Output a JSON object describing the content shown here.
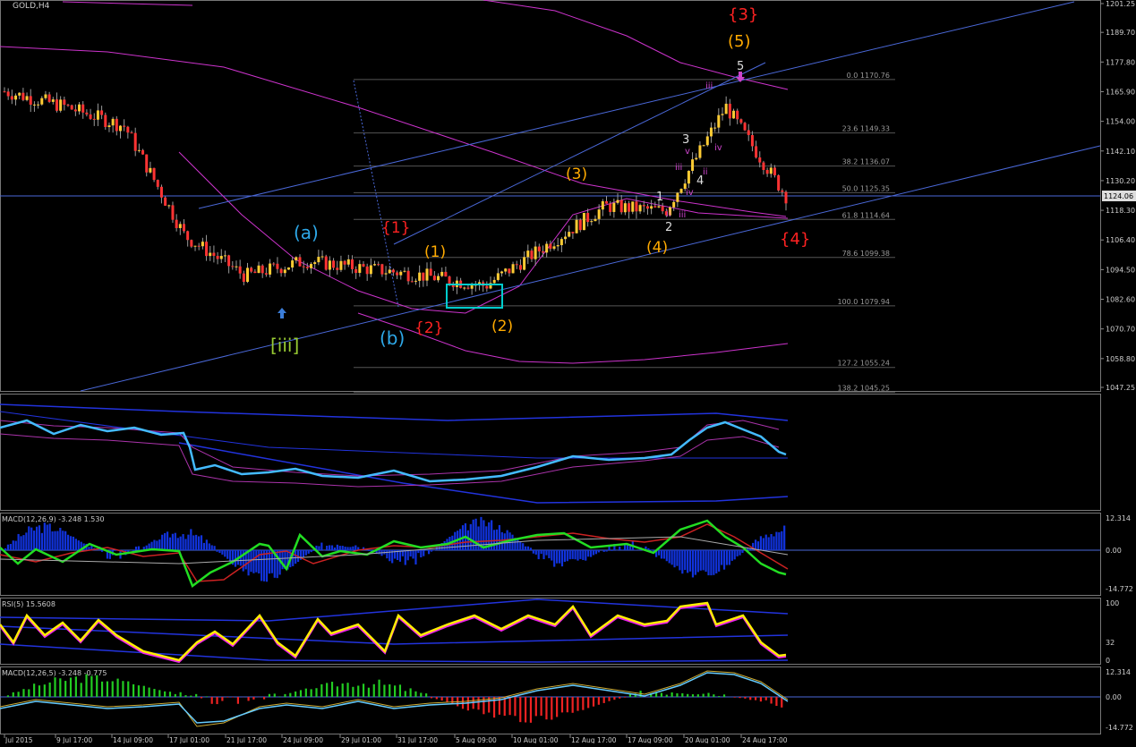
{
  "header": {
    "title": "GOLD,H4"
  },
  "colors": {
    "background": "#000000",
    "grid_line": "#4a4a4a",
    "bull_candle": "#ffcc33",
    "bear_candle": "#ff3333",
    "wick": "#9a9a9a",
    "ma_line": "#cc33cc",
    "trend_line": "#4a68d8",
    "fib_line": "#555555",
    "box": "#00cccc",
    "label_red": "#ff2222",
    "label_orange": "#ffaa00",
    "label_cyan": "#2ea8e8",
    "label_green": "#99cc33",
    "label_white": "#dddddd",
    "label_purple": "#cc44cc",
    "macd_hist": "#1133dd",
    "macd_fast": "#22dd22",
    "rsi_main": "#ffee00",
    "hist_green": "#22cc22",
    "hist_red": "#ee2222",
    "axis_text": "#cccccc"
  },
  "main_panel": {
    "price_axis": [
      "1201.25",
      "1189.70",
      "1177.80",
      "1165.90",
      "1154.00",
      "1142.10",
      "1130.20",
      "1118.30",
      "1106.40",
      "1094.50",
      "1082.60",
      "1070.70",
      "1058.80",
      "1047.25"
    ],
    "current_price": "1124.06",
    "fib_levels": [
      {
        "ratio": "0.0",
        "price": "1170.76"
      },
      {
        "ratio": "23.6",
        "price": "1149.33"
      },
      {
        "ratio": "38.2",
        "price": "1136.07"
      },
      {
        "ratio": "50.0",
        "price": "1125.35"
      },
      {
        "ratio": "61.8",
        "price": "1114.64"
      },
      {
        "ratio": "78.6",
        "price": "1099.38"
      },
      {
        "ratio": "100.0",
        "price": "1079.94"
      },
      {
        "ratio": "127.2",
        "price": "1055.24"
      },
      {
        "ratio": "138.2",
        "price": "1045.25"
      }
    ],
    "wave_labels": [
      {
        "text": "{3}",
        "role": "red"
      },
      {
        "text": "(5)",
        "role": "orange"
      },
      {
        "text": "5",
        "role": "white"
      },
      {
        "text": "(a)",
        "role": "cyan"
      },
      {
        "text": "{1}",
        "role": "red"
      },
      {
        "text": "(1)",
        "role": "orange"
      },
      {
        "text": "(3)",
        "role": "orange"
      },
      {
        "text": "3",
        "role": "white"
      },
      {
        "text": "4",
        "role": "white"
      },
      {
        "text": "1",
        "role": "white"
      },
      {
        "text": "2",
        "role": "white"
      },
      {
        "text": "(4)",
        "role": "orange"
      },
      {
        "text": "{4}",
        "role": "red"
      },
      {
        "text": "[iii]",
        "role": "green"
      },
      {
        "text": "(b)",
        "role": "cyan"
      },
      {
        "text": "{2}",
        "role": "red"
      },
      {
        "text": "(2)",
        "role": "orange"
      },
      {
        "text": "iii",
        "role": "purple"
      },
      {
        "text": "iv",
        "role": "purple"
      },
      {
        "text": "v",
        "role": "purple"
      },
      {
        "text": "iii",
        "role": "purple"
      },
      {
        "text": "iv",
        "role": "purple"
      },
      {
        "text": "ii",
        "role": "purple"
      },
      {
        "text": "ii",
        "role": "purple"
      },
      {
        "text": "iii",
        "role": "purple"
      }
    ]
  },
  "panels": {
    "indicator1": {
      "title": ""
    },
    "macd1": {
      "title": "MACD(12,26,9) -3.248 1.530",
      "axis": [
        "12.314",
        "0.00",
        "-14.772"
      ]
    },
    "rsi": {
      "title": "RSI(5) 15.5608",
      "axis": [
        "100",
        "32",
        "0"
      ]
    },
    "macd2": {
      "title": "MACD(12,26,5) -3.248 -0.775",
      "axis": [
        "12.314",
        "0.00",
        "-14.772"
      ]
    }
  },
  "time_axis": [
    "Jul 2015",
    "9 Jul 17:00",
    "14 Jul 09:00",
    "17 Jul 01:00",
    "21 Jul 17:00",
    "24 Jul 09:00",
    "29 Jul 01:00",
    "31 Jul 17:00",
    "5 Aug 09:00",
    "10 Aug 01:00",
    "12 Aug 17:00",
    "17 Aug 09:00",
    "20 Aug 01:00",
    "24 Aug 17:00"
  ],
  "chart_data": {
    "type": "candlestick",
    "symbol": "GOLD",
    "timeframe": "H4",
    "y_range": [
      1045.25,
      1201.25
    ],
    "close_path": [
      {
        "x": "Jul 2015",
        "close": 1166
      },
      {
        "x": "9 Jul 17:00",
        "close": 1160
      },
      {
        "x": "14 Jul 09:00",
        "close": 1152
      },
      {
        "x": "17 Jul 01:00",
        "close": 1108
      },
      {
        "x": "21 Jul 17:00",
        "close": 1092
      },
      {
        "x": "24 Jul 09:00",
        "close": 1098
      },
      {
        "x": "29 Jul 01:00",
        "close": 1095
      },
      {
        "x": "31 Jul 17:00",
        "close": 1092
      },
      {
        "x": "5 Aug 09:00",
        "close": 1088
      },
      {
        "x": "10 Aug 01:00",
        "close": 1104
      },
      {
        "x": "12 Aug 17:00",
        "close": 1120
      },
      {
        "x": "17 Aug 09:00",
        "close": 1118
      },
      {
        "x": "20 Aug 01:00",
        "close": 1160
      },
      {
        "x": "24 Aug 17:00",
        "close": 1124.06
      }
    ],
    "last_price": 1124.06
  }
}
